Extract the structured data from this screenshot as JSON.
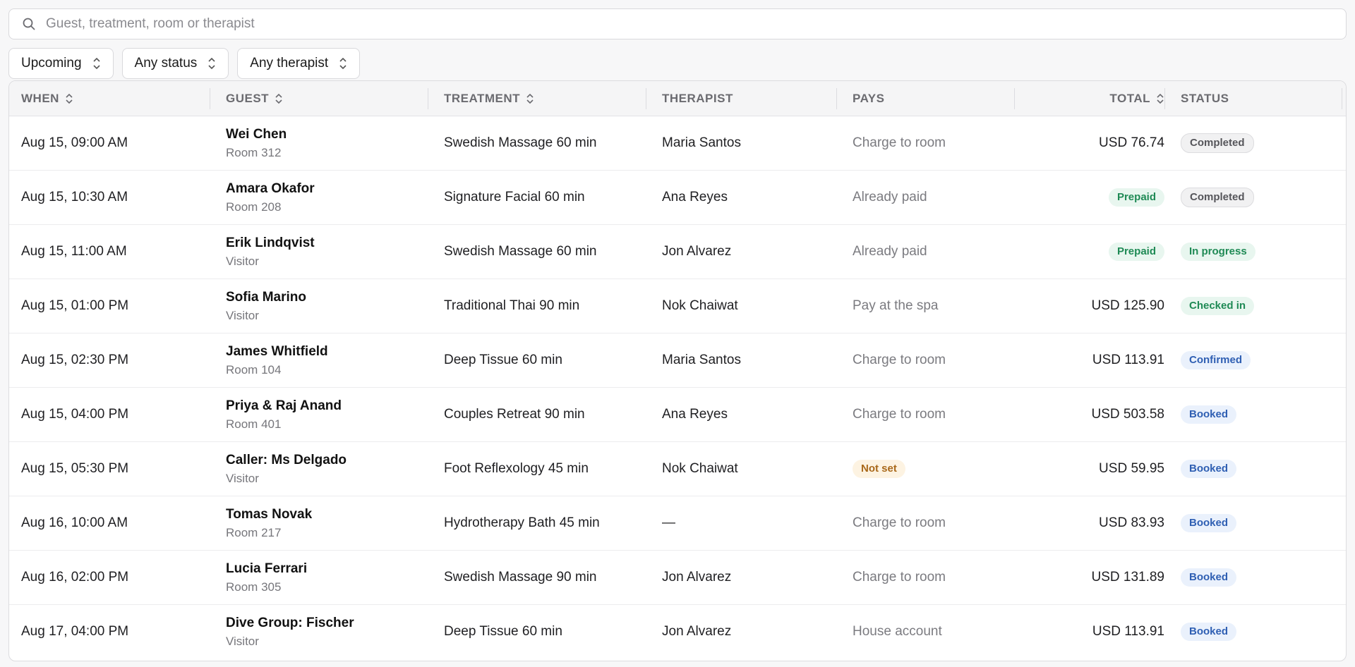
{
  "search": {
    "placeholder": "Guest, treatment, room or therapist",
    "value": ""
  },
  "filters": [
    {
      "label": "Upcoming"
    },
    {
      "label": "Any status"
    },
    {
      "label": "Any therapist"
    }
  ],
  "columns": {
    "when": "WHEN",
    "guest": "GUEST",
    "treatment": "TREATMENT",
    "therapist": "THERAPIST",
    "pays": "PAYS",
    "total": "TOTAL",
    "status": "STATUS"
  },
  "colors": {
    "completed": "#55555a",
    "green": "#1f8a55",
    "blue": "#2f5fb3",
    "amber": "#a9681a"
  },
  "rows": [
    {
      "when": "Aug 15, 09:00 AM",
      "guest": "Wei Chen",
      "sub": "Room 312",
      "treatment": "Swedish Massage 60 min",
      "therapist": "Maria Santos",
      "pays": "Charge to room",
      "pays_badge": false,
      "total": "USD 76.74",
      "total_badge": false,
      "status": "Completed",
      "status_style": "completed"
    },
    {
      "when": "Aug 15, 10:30 AM",
      "guest": "Amara Okafor",
      "sub": "Room 208",
      "treatment": "Signature Facial 60 min",
      "therapist": "Ana Reyes",
      "pays": "Already paid",
      "pays_badge": false,
      "total": "Prepaid",
      "total_badge": true,
      "status": "Completed",
      "status_style": "completed"
    },
    {
      "when": "Aug 15, 11:00 AM",
      "guest": "Erik Lindqvist",
      "sub": "Visitor",
      "treatment": "Swedish Massage 60 min",
      "therapist": "Jon Alvarez",
      "pays": "Already paid",
      "pays_badge": false,
      "total": "Prepaid",
      "total_badge": true,
      "status": "In progress",
      "status_style": "green"
    },
    {
      "when": "Aug 15, 01:00 PM",
      "guest": "Sofia Marino",
      "sub": "Visitor",
      "treatment": "Traditional Thai 90 min",
      "therapist": "Nok Chaiwat",
      "pays": "Pay at the spa",
      "pays_badge": false,
      "total": "USD 125.90",
      "total_badge": false,
      "status": "Checked in",
      "status_style": "green"
    },
    {
      "when": "Aug 15, 02:30 PM",
      "guest": "James Whitfield",
      "sub": "Room 104",
      "treatment": "Deep Tissue 60 min",
      "therapist": "Maria Santos",
      "pays": "Charge to room",
      "pays_badge": false,
      "total": "USD 113.91",
      "total_badge": false,
      "status": "Confirmed",
      "status_style": "blue"
    },
    {
      "when": "Aug 15, 04:00 PM",
      "guest": "Priya & Raj Anand",
      "sub": "Room 401",
      "treatment": "Couples Retreat 90 min",
      "therapist": "Ana Reyes",
      "pays": "Charge to room",
      "pays_badge": false,
      "total": "USD 503.58",
      "total_badge": false,
      "status": "Booked",
      "status_style": "blue"
    },
    {
      "when": "Aug 15, 05:30 PM",
      "guest": "Caller: Ms Delgado",
      "sub": "Visitor",
      "treatment": "Foot Reflexology 45 min",
      "therapist": "Nok Chaiwat",
      "pays": "Not set",
      "pays_badge": true,
      "total": "USD 59.95",
      "total_badge": false,
      "status": "Booked",
      "status_style": "blue"
    },
    {
      "when": "Aug 16, 10:00 AM",
      "guest": "Tomas Novak",
      "sub": "Room 217",
      "treatment": "Hydrotherapy Bath 45 min",
      "therapist": "—",
      "pays": "Charge to room",
      "pays_badge": false,
      "total": "USD 83.93",
      "total_badge": false,
      "status": "Booked",
      "status_style": "blue"
    },
    {
      "when": "Aug 16, 02:00 PM",
      "guest": "Lucia Ferrari",
      "sub": "Room 305",
      "treatment": "Swedish Massage 90 min",
      "therapist": "Jon Alvarez",
      "pays": "Charge to room",
      "pays_badge": false,
      "total": "USD 131.89",
      "total_badge": false,
      "status": "Booked",
      "status_style": "blue"
    },
    {
      "when": "Aug 17, 04:00 PM",
      "guest": "Dive Group: Fischer",
      "sub": "Visitor",
      "treatment": "Deep Tissue 60 min",
      "therapist": "Jon Alvarez",
      "pays": "House account",
      "pays_badge": false,
      "total": "USD 113.91",
      "total_badge": false,
      "status": "Booked",
      "status_style": "blue"
    }
  ]
}
